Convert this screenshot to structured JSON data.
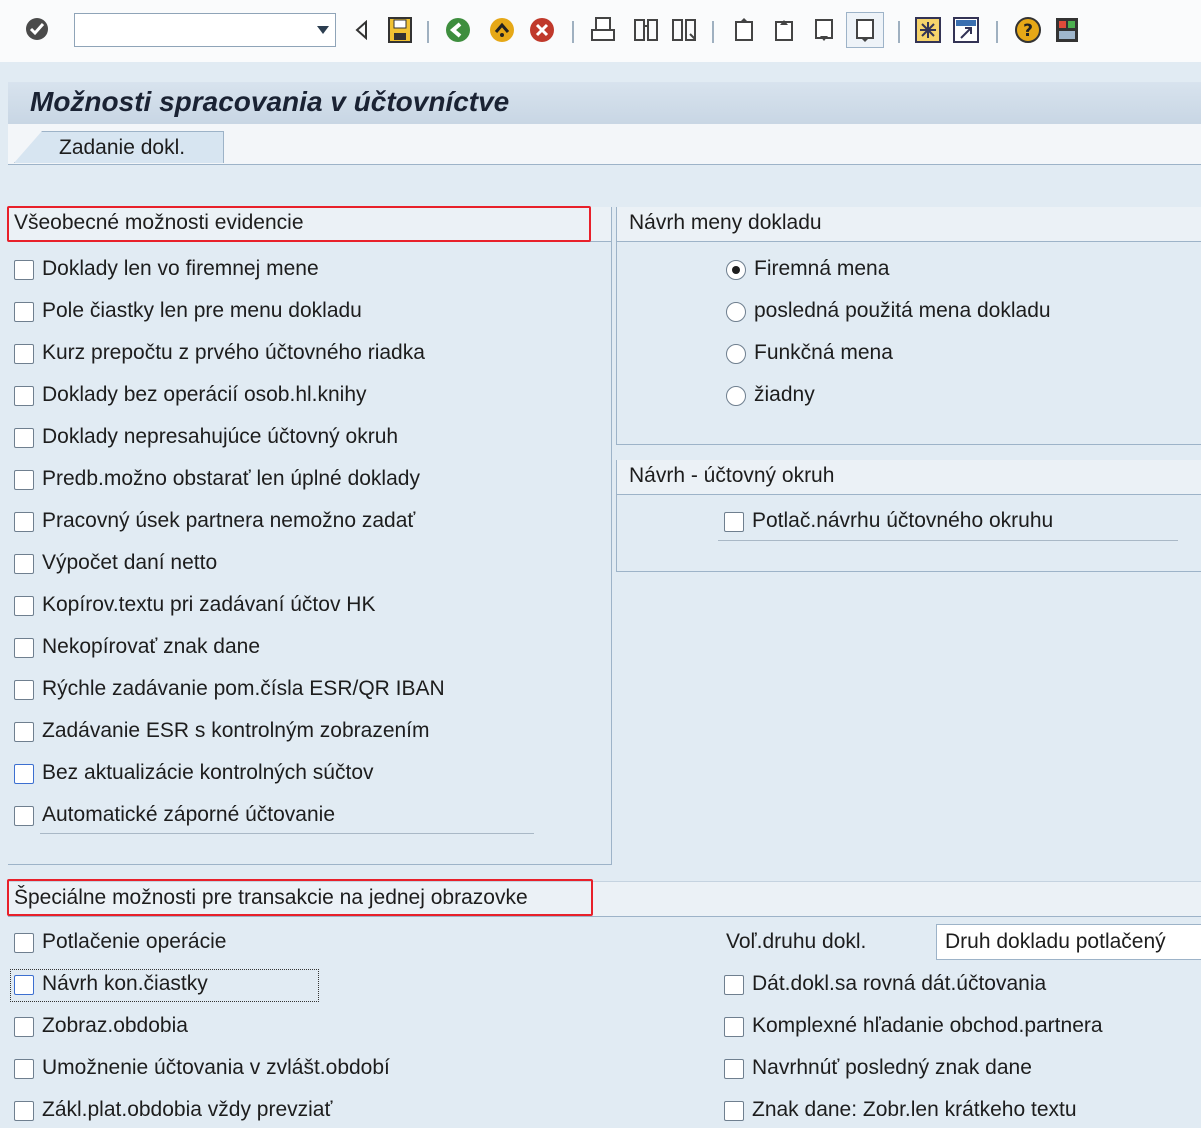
{
  "toolbar": {
    "command_field": {
      "value": "",
      "placeholder": ""
    },
    "icons": [
      "enter-icon",
      "back-arrow-icon",
      "save-icon",
      "back-icon",
      "exit-icon",
      "cancel-icon",
      "print-icon",
      "find-icon",
      "find-next-icon",
      "first-page-icon",
      "previous-page-icon",
      "next-page-icon",
      "last-page-icon",
      "create-session-icon",
      "shortcut-icon",
      "help-icon",
      "layout-menu-icon"
    ]
  },
  "page": {
    "title": "Možnosti spracovania v účtovníctve",
    "tab": "Zadanie dokl."
  },
  "general_options": {
    "header": "Všeobecné možnosti evidencie",
    "items": [
      {
        "label": "Doklady len vo firemnej mene",
        "checked": false
      },
      {
        "label": "Pole čiastky len pre menu dokladu",
        "checked": false
      },
      {
        "label": "Kurz prepočtu z prvého účtovného riadka",
        "checked": false
      },
      {
        "label": "Doklady bez operácií osob.hl.knihy",
        "checked": false
      },
      {
        "label": "Doklady nepresahujúce účtovný okruh",
        "checked": false
      },
      {
        "label": "Predb.možno obstarať len úplné doklady",
        "checked": false
      },
      {
        "label": "Pracovný úsek partnera nemožno zadať",
        "checked": false
      },
      {
        "label": "Výpočet daní netto",
        "checked": false
      },
      {
        "label": "Kopírov.textu pri zadávaní účtov HK",
        "checked": false
      },
      {
        "label": "Nekopírovať znak dane",
        "checked": false
      },
      {
        "label": "Rýchle zadávanie pom.čísla ESR/QR IBAN",
        "checked": false
      },
      {
        "label": "Zadávanie ESR s kontrolným zobrazením",
        "checked": false
      },
      {
        "label": "Bez aktualizácie kontrolných súčtov",
        "checked": false
      },
      {
        "label": "Automatické záporné účtovanie",
        "checked": false
      }
    ]
  },
  "currency_proposal": {
    "header": "Návrh meny dokladu",
    "options": [
      {
        "label": "Firemná mena",
        "selected": true
      },
      {
        "label": "posledná použitá mena dokladu",
        "selected": false
      },
      {
        "label": "Funkčná mena",
        "selected": false
      },
      {
        "label": "žiadny",
        "selected": false
      }
    ]
  },
  "company_code_proposal": {
    "header": "Návrh - účtovný okruh",
    "items": [
      {
        "label": "Potlač.návrhu účtovného okruhu",
        "checked": false
      }
    ]
  },
  "special_options": {
    "header": "Špeciálne možnosti pre transakcie na jednej obrazovke",
    "left_items": [
      {
        "label": "Potlačenie operácie",
        "checked": false
      },
      {
        "label": "Návrh kon.čiastky",
        "checked": false
      },
      {
        "label": "Zobraz.obdobia",
        "checked": false
      },
      {
        "label": "Umožnenie účtovania v zvlášt.období",
        "checked": false
      },
      {
        "label": "Zákl.plat.obdobia vždy prevziať",
        "checked": false
      }
    ],
    "doc_type_label": "Voľ.druhu dokl.",
    "doc_type_value": "Druh dokladu potlačený",
    "right_items": [
      {
        "label": "Dát.dokl.sa rovná dát.účtovania",
        "checked": false
      },
      {
        "label": "Komplexné hľadanie obchod.partnera",
        "checked": false
      },
      {
        "label": "Navrhnúť posledný znak dane",
        "checked": false
      },
      {
        "label": "Znak dane: Zobr.len krátkeho textu",
        "checked": false
      }
    ]
  },
  "colors": {
    "background": "#e1ebf3",
    "highlight": "#e8202a",
    "toolbar": "#fafbfc"
  }
}
